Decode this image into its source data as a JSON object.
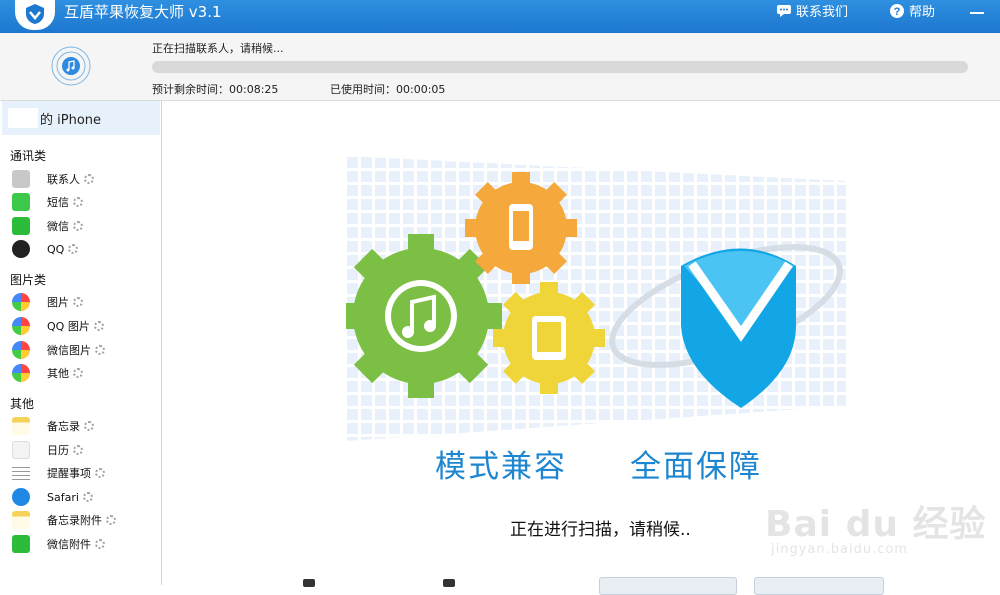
{
  "window": {
    "title": "互盾苹果恢复大师 v3.1",
    "contact_label": "联系我们",
    "help_label": "帮助"
  },
  "scan": {
    "status": "正在扫描联系人，请稍候...",
    "progress_fraction": 0.0,
    "remaining_label": "预计剩余时间：00:08:25",
    "used_label": "已使用时间：00:00:05"
  },
  "sidebar": {
    "device_label": "的 iPhone",
    "categories": [
      {
        "title": "通讯类",
        "items": [
          "联系人",
          "短信",
          "微信",
          "QQ"
        ]
      },
      {
        "title": "图片类",
        "items": [
          "图片",
          "QQ 图片",
          "微信图片",
          "其他"
        ]
      },
      {
        "title": "其他",
        "items": [
          "备忘录",
          "日历",
          "提醒事项",
          "Safari",
          "备忘录附件",
          "微信附件"
        ]
      }
    ]
  },
  "main": {
    "slogan_left": "模式兼容",
    "slogan_right": "全面保障",
    "scanning_text": "正在进行扫描，请稍候.."
  },
  "watermark": {
    "brand": "Bai du 经验",
    "url": "jingyan.baidu.com"
  },
  "colors": {
    "titlebar": "#1d78cf",
    "accent_blue": "#1e86d0",
    "gear_green": "#7cbf45",
    "gear_orange": "#f5a93c",
    "gear_yellow": "#efd537",
    "shield_blue": "#12a6e6"
  }
}
